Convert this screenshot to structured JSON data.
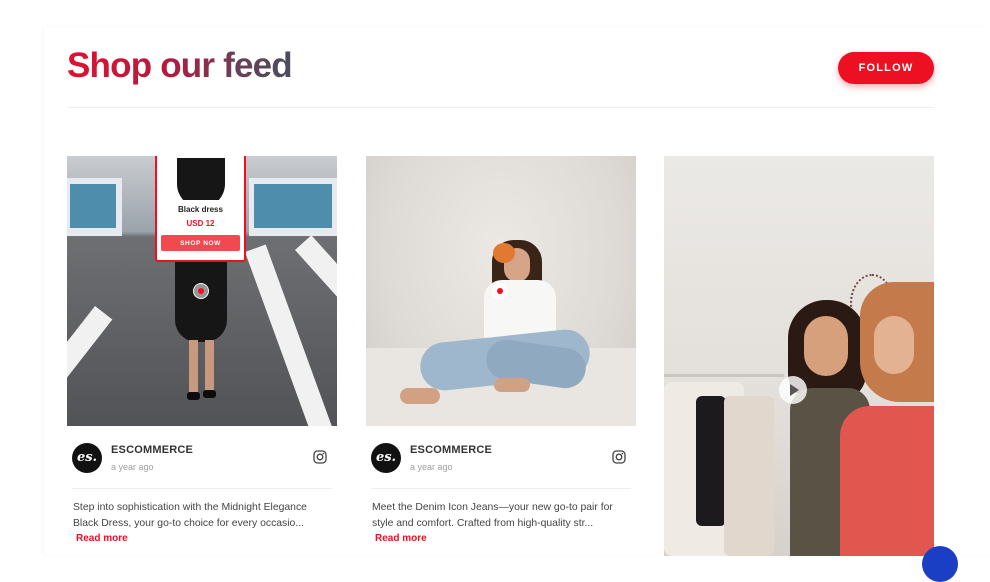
{
  "header": {
    "title": "Shop our feed",
    "follow_label": "FOLLOW"
  },
  "colors": {
    "accent": "#ec1022",
    "title_gradient": [
      "#e01230",
      "#494d5f"
    ]
  },
  "posts": [
    {
      "username": "ESCOMMERCE",
      "time": "a year ago",
      "caption": "Step into sophistication with the Midnight Elegance Black Dress, your go-to choice for every occasio...",
      "read_more": "Read more",
      "icon": "instagram-icon",
      "avatar_text": "es.",
      "product_tag": {
        "name": "Black dress",
        "price": "USD 12",
        "button": "SHOP NOW"
      }
    },
    {
      "username": "ESCOMMERCE",
      "time": "a year ago",
      "caption": "Meet the Denim Icon Jeans—your new go-to pair for style and comfort. Crafted from high-quality str...",
      "read_more": "Read more",
      "icon": "instagram-icon",
      "avatar_text": "es."
    },
    {
      "media": "video",
      "icon": "play-icon"
    }
  ]
}
